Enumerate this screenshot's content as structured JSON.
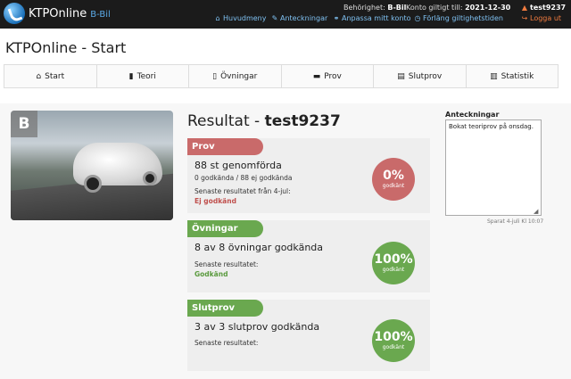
{
  "topbar": {
    "brand": "KTPOnline",
    "brand_sub": "B-Bil",
    "behorighet_label": "Behörighet:",
    "behorighet_value": "B-Bil",
    "konto_label": "Konto giltigt till:",
    "konto_value": "2021-12-30",
    "user": "test9237",
    "links": {
      "huvudmeny": "Huvudmeny",
      "anteckningar": "Anteckningar",
      "anpassa": "Anpassa mitt konto",
      "forlang": "Förläng giltighetstiden"
    },
    "logout": "Logga ut"
  },
  "page_title": "KTPOnline - Start",
  "tabs": [
    "Start",
    "Teori",
    "Övningar",
    "Prov",
    "Slutprov",
    "Statistik"
  ],
  "image_badge": "B",
  "result": {
    "prefix": "Resultat - ",
    "user": "test9237"
  },
  "cards": {
    "prov": {
      "header": "Prov",
      "line1": "88 st genomförda",
      "line2": "0 godkända / 88 ej godkända",
      "line3": "Senaste resultatet från 4-jul:",
      "line4": "Ej godkänd",
      "percent": "0%",
      "percent_label": "godkänt"
    },
    "ovningar": {
      "header": "Övningar",
      "line1": "8 av 8 övningar godkända",
      "line3": "Senaste resultatet:",
      "line4": "Godkänd",
      "percent": "100%",
      "percent_label": "godkänt"
    },
    "slutprov": {
      "header": "Slutprov",
      "line1": "3 av 3 slutprov godkända",
      "line3": "Senaste resultatet:",
      "percent": "100%",
      "percent_label": "godkänt"
    }
  },
  "notes": {
    "label": "Anteckningar",
    "value": "Bokat teoriprov på onsdag.",
    "saved": "Sparat 4-juli Kl 10:07"
  },
  "colors": {
    "fail": "#c96a6a",
    "pass": "#6aa84f"
  }
}
